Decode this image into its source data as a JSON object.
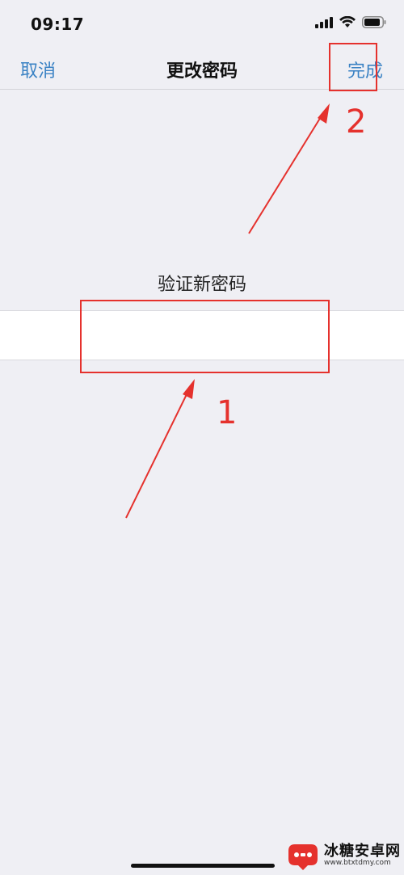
{
  "status_bar": {
    "time": "09:17"
  },
  "nav": {
    "cancel_label": "取消",
    "title": "更改密码",
    "done_label": "完成",
    "accent_color": "#3a82c4"
  },
  "form": {
    "verify_label": "验证新密码",
    "password_value": "",
    "password_placeholder": ""
  },
  "annotations": {
    "color": "#e5312d",
    "step1": "1",
    "step2": "2"
  },
  "watermark": {
    "title": "冰糖安卓网",
    "url": "www.btxtdmy.com"
  },
  "icons": [
    "signal-icon",
    "wifi-icon",
    "battery-icon",
    "watermark-logo-icon"
  ]
}
